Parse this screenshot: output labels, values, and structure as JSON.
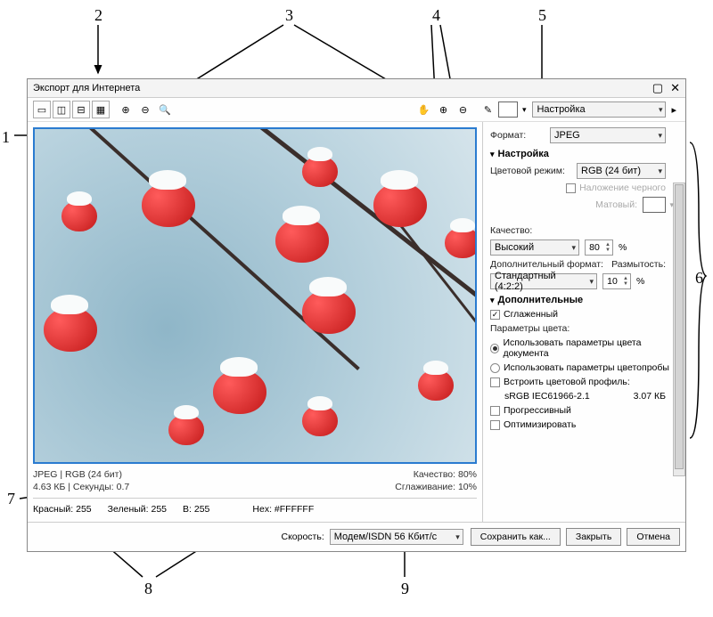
{
  "callouts": [
    "1",
    "2",
    "3",
    "4",
    "5",
    "6",
    "7",
    "8",
    "9"
  ],
  "title": "Экспорт для Интернета",
  "toolbar": {
    "preset_label": "Настройка"
  },
  "format": {
    "label": "Формат:",
    "value": "JPEG"
  },
  "sections": {
    "settings": "Настройка",
    "advanced": "Дополнительные"
  },
  "color_mode": {
    "label": "Цветовой режим:",
    "value": "RGB (24 бит)"
  },
  "overlay_black": "Наложение черного",
  "matte_label": "Матовый:",
  "quality": {
    "label": "Качество:",
    "preset": "Высокий",
    "value": "80",
    "pct": "%"
  },
  "subformat": {
    "label": "Дополнительный формат:",
    "value": "Стандартный (4:2:2)",
    "blur_label": "Размытость:",
    "blur_value": "10"
  },
  "advanced": {
    "antialiased": "Сглаженный",
    "color_params": "Параметры цвета:",
    "use_doc": "Использовать параметры цвета документа",
    "use_proof": "Использовать параметры цветопробы",
    "embed": "Встроить цветовой профиль:",
    "profile": "sRGB IEC61966-2.1",
    "profile_size": "3.07 КБ",
    "progressive": "Прогрессивный",
    "optimized": "Оптимизировать"
  },
  "status": {
    "mode": "JPEG  |  RGB (24 бит)",
    "size_time": "4.63 КБ  |  Секунды: 0.7",
    "quality": "Качество: 80%",
    "smoothing": "Сглаживание: 10%"
  },
  "color_readout": {
    "r_label": "Красный:",
    "r": "255",
    "g_label": "Зеленый:",
    "g": "255",
    "b_label": "B:",
    "b": "255",
    "hex_label": "Hex:",
    "hex": "#FFFFFF"
  },
  "speed": {
    "label": "Скорость:",
    "value": "Модем/ISDN 56 Кбит/с"
  },
  "buttons": {
    "save_as": "Сохранить как...",
    "close": "Закрыть",
    "cancel": "Отмена"
  }
}
